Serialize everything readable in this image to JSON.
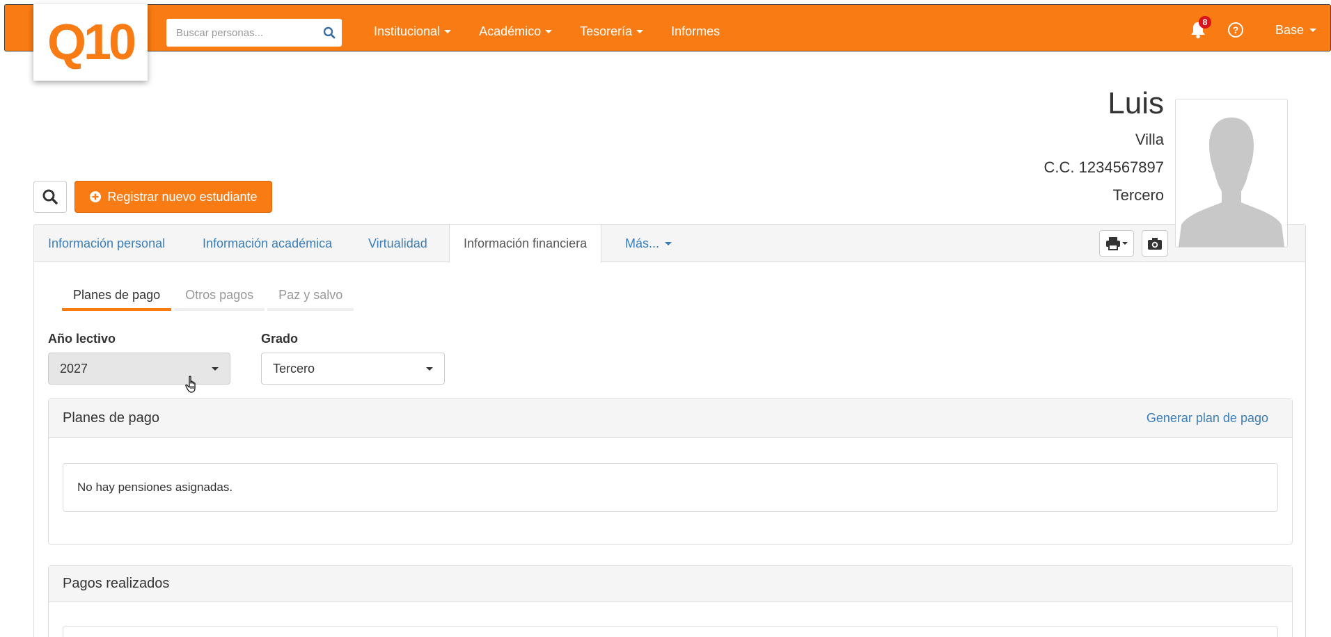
{
  "logo": {
    "text": "Q10"
  },
  "search": {
    "placeholder": "Buscar personas..."
  },
  "nav": {
    "items": [
      {
        "label": "Institucional",
        "dropdown": true
      },
      {
        "label": "Académico",
        "dropdown": true
      },
      {
        "label": "Tesorería",
        "dropdown": true
      },
      {
        "label": "Informes",
        "dropdown": false
      }
    ],
    "notifications_count": "8",
    "user_label": "Base"
  },
  "student": {
    "first_name": "Luis",
    "last_name": "Villa",
    "id_doc": "C.C. 1234567897",
    "grade": "Tercero"
  },
  "actions": {
    "register_label": "Registrar nuevo estudiante"
  },
  "tabs": [
    {
      "label": "Información personal"
    },
    {
      "label": "Información académica"
    },
    {
      "label": "Virtualidad"
    },
    {
      "label": "Información financiera"
    },
    {
      "label": "Más..."
    }
  ],
  "subtabs": [
    {
      "label": "Planes de pago"
    },
    {
      "label": "Otros pagos"
    },
    {
      "label": "Paz y salvo"
    }
  ],
  "filters": {
    "year_label": "Año lectivo",
    "year_value": "2027",
    "grade_label": "Grado",
    "grade_value": "Tercero"
  },
  "payment_plans": {
    "title": "Planes de pago",
    "link": "Generar plan de pago",
    "empty_text": "No hay pensiones asignadas."
  },
  "payments": {
    "title": "Pagos realizados"
  },
  "colors": {
    "brand": "#f97b14",
    "link": "#3a7db8",
    "badge": "#d9121b"
  },
  "icons": [
    "search-icon",
    "bell-icon",
    "help-icon",
    "plus-circle-icon",
    "print-icon",
    "camera-icon",
    "avatar-silhouette-icon",
    "hand-cursor-icon"
  ]
}
